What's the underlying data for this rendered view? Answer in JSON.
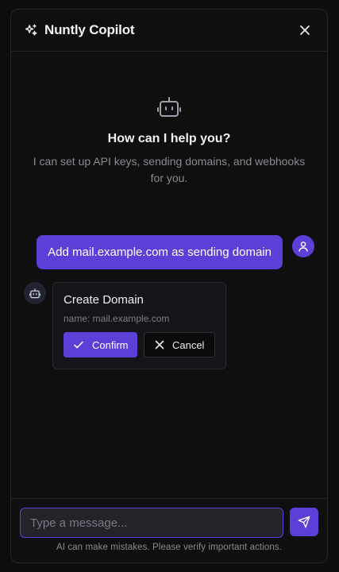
{
  "header": {
    "logo_icon": "sparkles-icon",
    "title": "Nuntly Copilot",
    "close_icon": "close-icon"
  },
  "welcome": {
    "icon": "bot-icon",
    "heading": "How can I help you?",
    "subtitle": "I can set up API keys, sending domains, and webhooks for you."
  },
  "messages": {
    "user": {
      "text": "Add mail.example.com as sending domain",
      "avatar_icon": "user-icon"
    },
    "assistant": {
      "avatar_icon": "bot-icon",
      "card": {
        "title": "Create Domain",
        "detail": "name: mail.example.com",
        "confirm_label": "Confirm",
        "cancel_label": "Cancel"
      }
    }
  },
  "composer": {
    "placeholder": "Type a message...",
    "send_icon": "send-icon",
    "disclaimer": "AI can make mistakes. Please verify important actions."
  },
  "colors": {
    "accent": "#5b3fd6",
    "background": "#0f0f10",
    "card": "#141519"
  }
}
